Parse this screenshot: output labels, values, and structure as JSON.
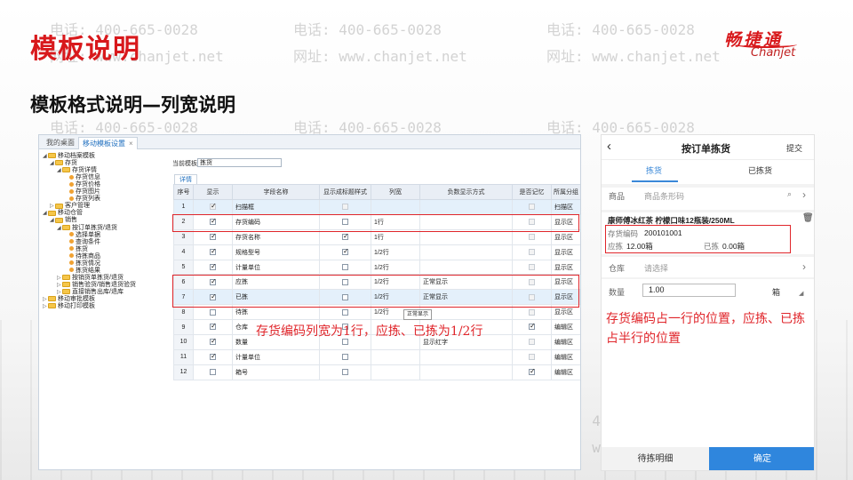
{
  "slide": {
    "title": "模板说明",
    "subtitle": "模板格式说明—列宽说明",
    "watermark_phone": "电话: 400-665-0028",
    "watermark_site": "网址: www.chanjet.net"
  },
  "logo": {
    "cn": "畅捷通",
    "en": "Chanjet"
  },
  "app": {
    "tabs": [
      "我的桌面",
      "移动模板设置"
    ],
    "tab_close": "×",
    "tree": [
      {
        "label": "移动档案模板",
        "kind": "folder",
        "open": true
      },
      {
        "label": "存货",
        "kind": "folder",
        "open": true
      },
      {
        "label": "存货详情",
        "kind": "folder",
        "open": true
      },
      {
        "label": "存货信息",
        "kind": "leaf"
      },
      {
        "label": "存货价格",
        "kind": "leaf"
      },
      {
        "label": "存货图片",
        "kind": "leaf"
      },
      {
        "label": "存货列表",
        "kind": "leaf"
      },
      {
        "label": "客户管理",
        "kind": "folder",
        "open": false
      },
      {
        "label": "移动仓管",
        "kind": "folder",
        "open": true
      },
      {
        "label": "销售",
        "kind": "folder",
        "open": true
      },
      {
        "label": "按订单拣货/退货",
        "kind": "folder",
        "open": true
      },
      {
        "label": "选择单据",
        "kind": "leaf"
      },
      {
        "label": "查询条件",
        "kind": "leaf"
      },
      {
        "label": "拣货",
        "kind": "leaf"
      },
      {
        "label": "待拣商品",
        "kind": "leaf"
      },
      {
        "label": "拣货情况",
        "kind": "leaf"
      },
      {
        "label": "拣货结果",
        "kind": "leaf"
      },
      {
        "label": "按销货单拣货/退货",
        "kind": "folder",
        "open": false
      },
      {
        "label": "销售验货/销售退货验货",
        "kind": "folder",
        "open": false
      },
      {
        "label": "直接销售出库/退库",
        "kind": "folder",
        "open": false
      },
      {
        "label": "移动审批模板",
        "kind": "folder",
        "open": false
      },
      {
        "label": "移动打印模板",
        "kind": "folder",
        "open": false
      }
    ],
    "current_template_label": "当前模板:",
    "current_template_value": "拣货",
    "detail_tab": "详情",
    "columns": [
      "序号",
      "显示",
      "字段名称",
      "显示成标题样式",
      "列宽",
      "负数显示方式",
      "是否记忆",
      "所属分组"
    ],
    "rows": [
      {
        "no": "1",
        "show": "on-dis",
        "name": "扫描框",
        "title_style": "off-dis",
        "width": "",
        "neg": "",
        "remember": "off-dis",
        "group": "扫描区",
        "hl": true
      },
      {
        "no": "2",
        "show": "on",
        "name": "存货编码",
        "title_style": "off",
        "width": "1行",
        "neg": "",
        "remember": "off-dis",
        "group": "显示区",
        "hl": false
      },
      {
        "no": "3",
        "show": "on",
        "name": "存货名称",
        "title_style": "on",
        "width": "1行",
        "neg": "",
        "remember": "off-dis",
        "group": "显示区",
        "hl": false
      },
      {
        "no": "4",
        "show": "on",
        "name": "规格型号",
        "title_style": "on",
        "width": "1/2行",
        "neg": "",
        "remember": "off-dis",
        "group": "显示区",
        "hl": false
      },
      {
        "no": "5",
        "show": "on",
        "name": "计量单位",
        "title_style": "off",
        "width": "1/2行",
        "neg": "",
        "remember": "off-dis",
        "group": "显示区",
        "hl": false
      },
      {
        "no": "6",
        "show": "on",
        "name": "应拣",
        "title_style": "off",
        "width": "1/2行",
        "neg": "正常显示",
        "remember": "off-dis",
        "group": "显示区",
        "hl": false
      },
      {
        "no": "7",
        "show": "on",
        "name": "已拣",
        "title_style": "off",
        "width": "1/2行",
        "neg": "正常显示",
        "remember": "off-dis",
        "group": "显示区",
        "hl": true
      },
      {
        "no": "8",
        "show": "off",
        "name": "待拣",
        "title_style": "off",
        "width": "1/2行",
        "neg": "",
        "remember": "off-dis",
        "group": "显示区",
        "hl": false
      },
      {
        "no": "9",
        "show": "on",
        "name": "仓库",
        "title_style": "off",
        "width": "",
        "neg": "",
        "remember": "on",
        "group": "编辑区",
        "hl": false
      },
      {
        "no": "10",
        "show": "on",
        "name": "数量",
        "title_style": "off",
        "width": "",
        "neg": "显示红字",
        "remember": "off-dis",
        "group": "编辑区",
        "hl": false
      },
      {
        "no": "11",
        "show": "on",
        "name": "计量单位",
        "title_style": "off",
        "width": "",
        "neg": "",
        "remember": "off-dis",
        "group": "编辑区",
        "hl": false
      },
      {
        "no": "12",
        "show": "off",
        "name": "箱号",
        "title_style": "off",
        "width": "",
        "neg": "",
        "remember": "on",
        "group": "编辑区",
        "hl": false
      }
    ],
    "dropdown_tip": "正常显示",
    "annotation": "存货编码列宽为1行，应拣、已拣为1/2行"
  },
  "phone": {
    "title": "按订单拣货",
    "submit": "提交",
    "back": "‹",
    "tab_active": "拣货",
    "tab_other": "已拣货",
    "product_label": "商品",
    "product_placeholder": "商品条形码",
    "item_name": "康师傅冰红茶 柠檬口味12瓶装/250ML",
    "code_label": "存货编码",
    "code_value": "200101001",
    "should_label": "应拣",
    "should_value": "12.00箱",
    "picked_label": "已拣",
    "picked_value": "0.00箱",
    "warehouse_label": "仓库",
    "warehouse_placeholder": "请选择",
    "qty_label": "数量",
    "qty_value": "1.00",
    "unit": "箱",
    "annotation": "存货编码占一行的位置，应拣、已拣占半行的位置",
    "btn_detail": "待拣明细",
    "btn_ok": "确定",
    "icons": {
      "search": "search-icon",
      "chevron": "chevron-right-icon",
      "trash": "trash-icon"
    }
  },
  "colors": {
    "accent_red": "#e0262b",
    "brand_blue": "#2f86dd"
  }
}
